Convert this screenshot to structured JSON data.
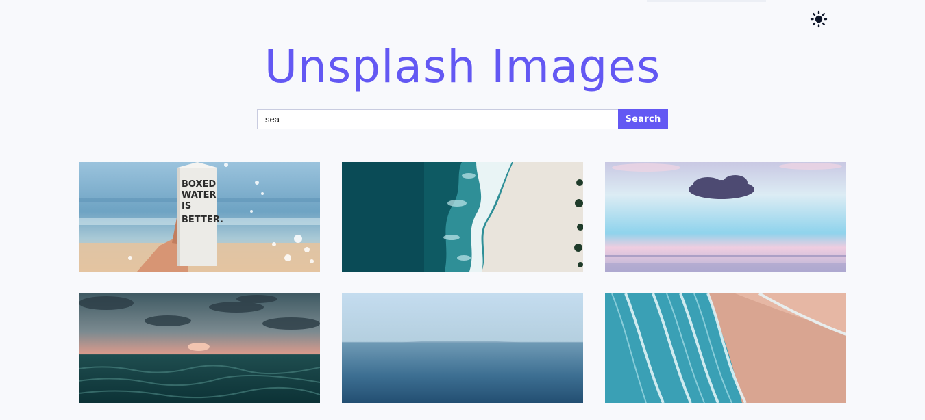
{
  "header": {
    "title": "Unsplash Images",
    "theme_toggle_icon": "sun-icon"
  },
  "search": {
    "value": "sea",
    "button_label": "Search"
  },
  "colors": {
    "accent": "#6358f3",
    "background": "#f8f9fc",
    "input_border": "#c9cce0"
  },
  "gallery": {
    "items": [
      {
        "subject": "hand holding boxed water carton at beach",
        "carton_text": [
          "BOXED",
          "WATER",
          "IS",
          "BETTER."
        ]
      },
      {
        "subject": "aerial turquoise waves meeting white sand"
      },
      {
        "subject": "dark cloud over pastel pink sea horizon"
      },
      {
        "subject": "sunset over dark green sea waves"
      },
      {
        "subject": "calm blue open sea under pale sky"
      },
      {
        "subject": "aerial foamy waves on pink sand beach"
      }
    ]
  }
}
